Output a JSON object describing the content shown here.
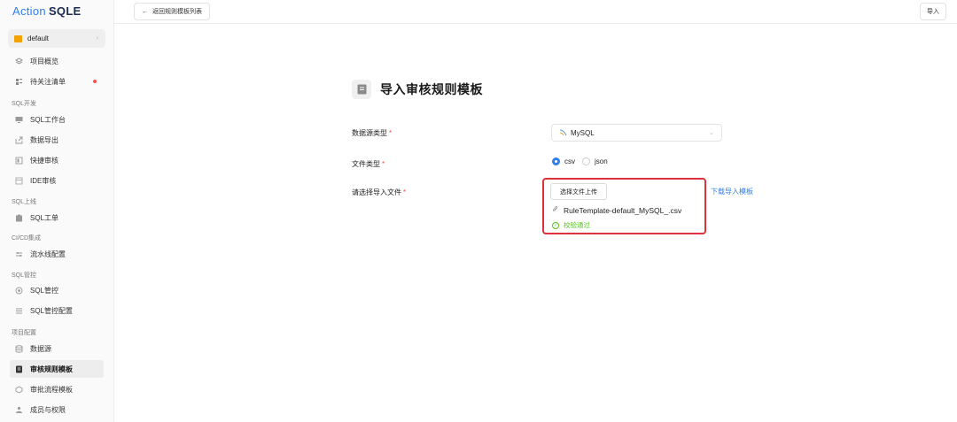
{
  "brand": {
    "part1": "Action",
    "part2": "SQLE"
  },
  "project": {
    "name": "default",
    "arrow": "›"
  },
  "sidebar": {
    "items": [
      {
        "label": "项目概览",
        "icon": "overview-icon"
      },
      {
        "label": "待关注清单",
        "icon": "watchlist-icon",
        "badge": "dot"
      }
    ],
    "groups": [
      {
        "label": "SQL开发",
        "items": [
          {
            "label": "SQL工作台",
            "icon": "workbench-icon"
          },
          {
            "label": "数据导出",
            "icon": "export-icon"
          },
          {
            "label": "快捷审核",
            "icon": "quick-audit-icon"
          },
          {
            "label": "IDE审核",
            "icon": "ide-audit-icon"
          }
        ]
      },
      {
        "label": "SQL上线",
        "items": [
          {
            "label": "SQL工单",
            "icon": "ticket-icon"
          }
        ]
      },
      {
        "label": "CI/CD集成",
        "items": [
          {
            "label": "流水线配置",
            "icon": "pipeline-icon"
          }
        ]
      },
      {
        "label": "SQL管控",
        "items": [
          {
            "label": "SQL管控",
            "icon": "control-icon"
          },
          {
            "label": "SQL管控配置",
            "icon": "control-config-icon"
          }
        ]
      },
      {
        "label": "项目配置",
        "items": [
          {
            "label": "数据源",
            "icon": "datasource-icon"
          },
          {
            "label": "审核规则模板",
            "icon": "rule-template-icon",
            "active": true
          },
          {
            "label": "审批流程模板",
            "icon": "approval-flow-icon"
          },
          {
            "label": "成员与权限",
            "icon": "members-icon"
          }
        ]
      }
    ]
  },
  "header": {
    "back_label": "返回规则模板列表",
    "back_icon": "arrow-left-icon",
    "import_label": "导入"
  },
  "form": {
    "title": "导入审核规则模板",
    "db_type_label": "数据源类型",
    "db_type_value": "MySQL",
    "file_type_label": "文件类型",
    "file_type_options": [
      "csv",
      "json"
    ],
    "file_type_selected": "csv",
    "file_label": "请选择导入文件",
    "upload_button": "选择文件上传",
    "download_link": "下载导入模板",
    "file_name": "RuleTemplate-default_MySQL_.csv",
    "verify_text": "校验通过",
    "required_mark": "*"
  },
  "colors": {
    "accent": "#2f7ff0",
    "success": "#52c41a",
    "highlight": "#e0303b",
    "required": "#ff4d4f"
  }
}
